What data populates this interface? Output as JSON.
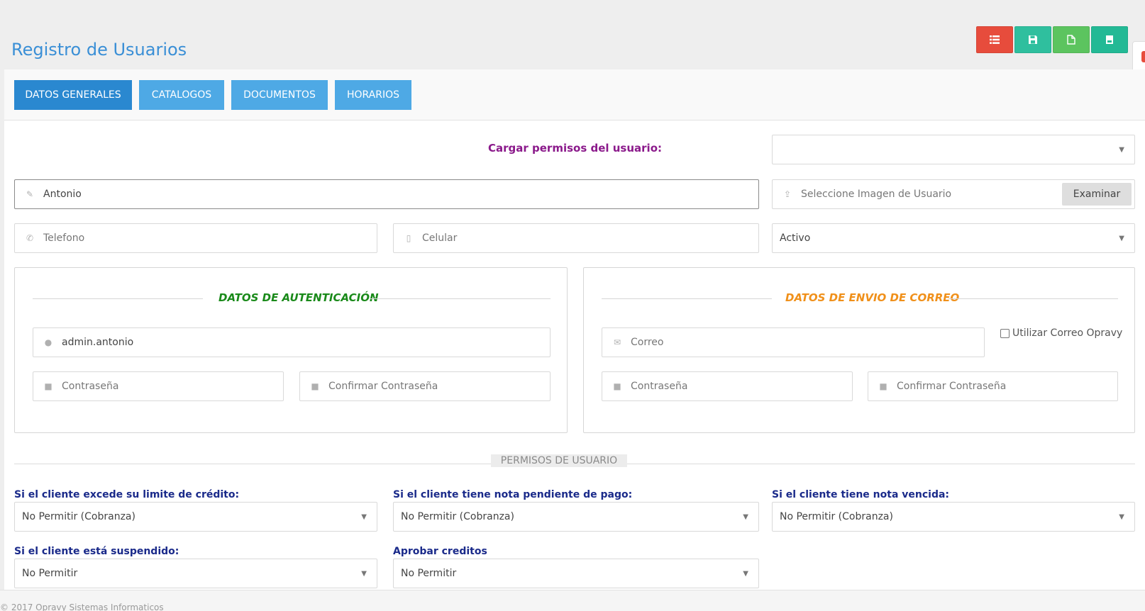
{
  "page": {
    "title": "Registro de Usuarios"
  },
  "toolbar": {
    "buttons": [
      {
        "name": "list",
        "icon": "list-icon",
        "color": "#e74c3c"
      },
      {
        "name": "save",
        "icon": "floppy-icon",
        "color": "#2fbf9e"
      },
      {
        "name": "new",
        "icon": "file-icon",
        "color": "#5cc45f"
      },
      {
        "name": "bookmark",
        "icon": "bookmark-icon",
        "color": "#23b995"
      }
    ]
  },
  "tabs": [
    {
      "label": "DATOS GENERALES",
      "active": true
    },
    {
      "label": "CATALOGOS",
      "active": false
    },
    {
      "label": "DOCUMENTOS",
      "active": false
    },
    {
      "label": "HORARIOS",
      "active": false
    }
  ],
  "permisos_carga": {
    "label": "Cargar permisos del usuario:",
    "value": ""
  },
  "nombre": {
    "value": "Antonio",
    "icon": "edit-icon"
  },
  "imagen": {
    "placeholder": "Seleccione Imagen de Usuario",
    "button": "Examinar",
    "icon": "upload-icon"
  },
  "telefono": {
    "placeholder": "Telefono",
    "icon": "phone-icon"
  },
  "celular": {
    "placeholder": "Celular",
    "icon": "mobile-icon"
  },
  "estado": {
    "value": "Activo"
  },
  "autenticacion": {
    "title": "DATOS DE AUTENTICACIÓN",
    "usuario": "admin.antonio",
    "password_placeholder": "Contraseña",
    "confirm_placeholder": "Confirmar Contraseña"
  },
  "correo_envio": {
    "title": "DATOS DE ENVIO DE CORREO",
    "correo_placeholder": "Correo",
    "checkbox_label": "Utilizar Correo Opravy",
    "password_placeholder": "Contraseña",
    "confirm_placeholder": "Confirmar Contraseña"
  },
  "permisos": {
    "title": "PERMISOS DE USUARIO",
    "limite_credito": {
      "label": "Si el cliente excede su limite de crédito:",
      "value": "No Permitir (Cobranza)"
    },
    "nota_pendiente": {
      "label": "Si el cliente tiene nota pendiente de pago:",
      "value": "No Permitir (Cobranza)"
    },
    "nota_vencida": {
      "label": "Si el cliente tiene nota vencida:",
      "value": "No Permitir (Cobranza)"
    },
    "suspendido": {
      "label": "Si el cliente está suspendido:",
      "value": "No Permitir"
    },
    "aprobar_creditos": {
      "label": "Aprobar creditos",
      "value": "No Permitir"
    }
  },
  "footer": {
    "text": "© 2017 Opravy Sistemas Informaticos"
  },
  "colors": {
    "accent": "#3a8fd6",
    "tab": "#4ea9e5",
    "tab_active": "#2a88d0"
  }
}
